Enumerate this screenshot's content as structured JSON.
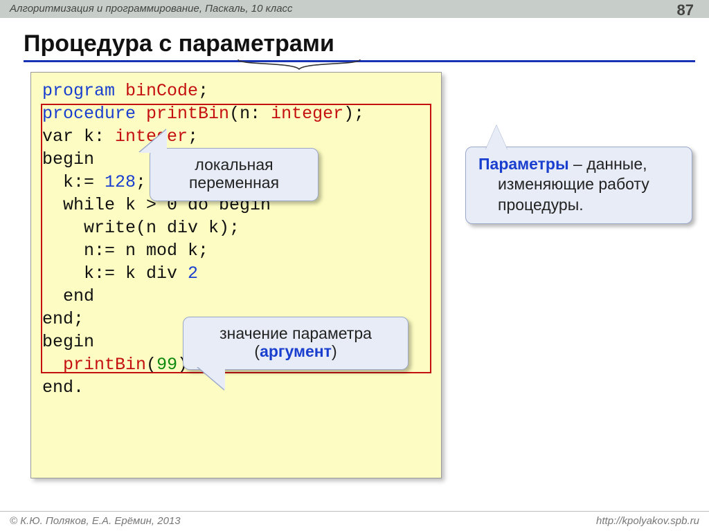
{
  "header": {
    "breadcrumb": "Алгоритмизация и программирование, Паскаль, 10 класс",
    "page_number": "87"
  },
  "title": "Процедура с параметрами",
  "code": {
    "l1_a": "program ",
    "l1_b": "binCode",
    "l1_c": ";",
    "l2_a": "procedure ",
    "l2_b": "printBin",
    "l2_c": "(n: ",
    "l2_d": "integer",
    "l2_e": ");",
    "l3_a": "var k: ",
    "l3_b": "integer",
    "l3_c": ";",
    "l4": "begin",
    "l5_a": "  k:= ",
    "l5_b": "128",
    "l5_c": ";",
    "l6": "  while k > 0 do begin",
    "l7": "    write(n div k);",
    "l8": "    n:= n mod k;",
    "l9_a": "    k:= k div ",
    "l9_b": "2",
    "l10": "  end",
    "l11": "end;",
    "l12": "begin",
    "l13_a": "  ",
    "l13_b": "printBin",
    "l13_c": "(",
    "l13_d": "99",
    "l13_e": ")",
    "l14": "end."
  },
  "callouts": {
    "local_var_l1": "локальная",
    "local_var_l2": "переменная",
    "params_bold": "Параметры",
    "params_rest1": " – данные,",
    "params_rest2": "изменяющие работу",
    "params_rest3": "процедуры.",
    "arg_l1": "значение параметра",
    "arg_l2a": "(",
    "arg_l2b": "аргумент",
    "arg_l2c": ")"
  },
  "footer": {
    "left": "© К.Ю. Поляков, Е.А. Ерёмин, 2013",
    "right": "http://kpolyakov.spb.ru"
  }
}
